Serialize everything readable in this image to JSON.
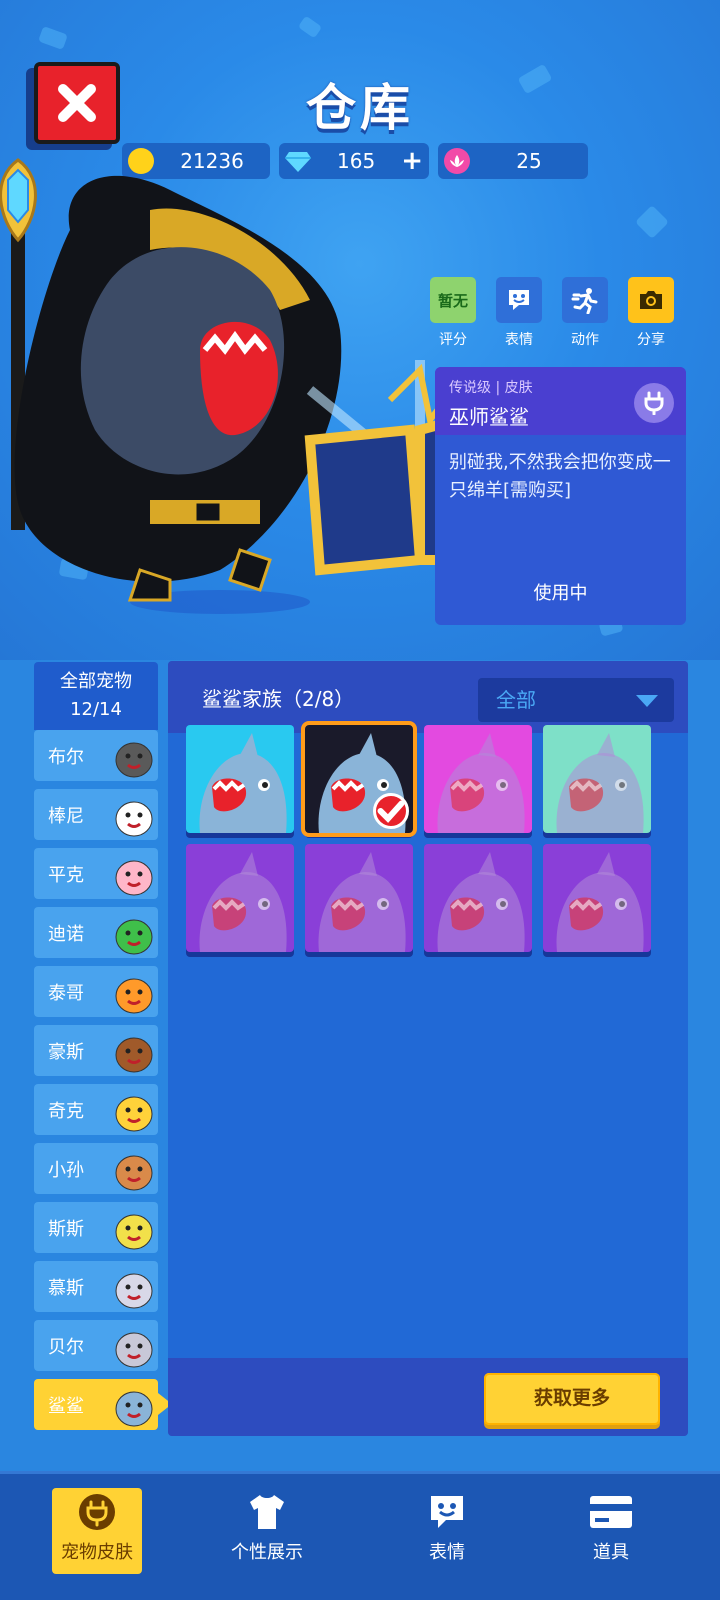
{
  "header": {
    "title": "仓库",
    "coins": "21236",
    "gems": "165",
    "gems_plus": "+",
    "lotus": "25"
  },
  "actions": [
    {
      "box_text": "暂无",
      "label": "评分",
      "icon": "rating-badge",
      "color": "#8ed36e"
    },
    {
      "box_text": "",
      "label": "表情",
      "icon": "emoji-icon",
      "color": "#2f6fd8"
    },
    {
      "box_text": "",
      "label": "动作",
      "icon": "running-icon",
      "color": "#2f6fd8"
    },
    {
      "box_text": "",
      "label": "分享",
      "icon": "camera-icon",
      "color": "#ffc21a"
    }
  ],
  "skin_info": {
    "rarity": "传说级",
    "type": "皮肤",
    "name": "巫师鲨鲨",
    "description": "别碰我,不然我会把你变成一只绵羊[需购买]",
    "status": "使用中"
  },
  "pets": {
    "all_label": "全部宠物",
    "all_count": "12/14",
    "items": [
      {
        "name": "布尔",
        "icon": "bull-icon",
        "color": "#5a5a5a"
      },
      {
        "name": "棒尼",
        "icon": "rabbit-icon",
        "color": "#ffffff"
      },
      {
        "name": "平克",
        "icon": "pig-icon",
        "color": "#ffb6c8"
      },
      {
        "name": "迪诺",
        "icon": "dino-icon",
        "color": "#3fbf4a"
      },
      {
        "name": "泰哥",
        "icon": "tiger-icon",
        "color": "#ff9a2a"
      },
      {
        "name": "豪斯",
        "icon": "horse-icon",
        "color": "#a05a2a"
      },
      {
        "name": "奇克",
        "icon": "chick-icon",
        "color": "#ffd23a"
      },
      {
        "name": "小孙",
        "icon": "monkey-icon",
        "color": "#d98a4a"
      },
      {
        "name": "斯斯",
        "icon": "snake-icon",
        "color": "#f2e04a"
      },
      {
        "name": "慕斯",
        "icon": "mouse-icon",
        "color": "#d8d8e8"
      },
      {
        "name": "贝尔",
        "icon": "seal-icon",
        "color": "#c8c8d8"
      },
      {
        "name": "鲨鲨",
        "icon": "shark-icon",
        "color": "#8ab4d8"
      }
    ],
    "active_index": 11
  },
  "skins_panel": {
    "family_label": "鲨鲨家族（2/8）",
    "filter_value": "全部",
    "get_more": "获取更多",
    "tiles": [
      {
        "name": "shark-default-skin",
        "bg": "#29c9f0",
        "owned": true,
        "selected": false
      },
      {
        "name": "shark-wizard-skin",
        "bg": "#1a1a2a",
        "owned": true,
        "selected": true
      },
      {
        "name": "shark-mushroom-skin",
        "bg": "#e34ae0",
        "owned": false,
        "selected": false
      },
      {
        "name": "shark-dino-skin",
        "bg": "#7ee0c8",
        "owned": false,
        "selected": false
      },
      {
        "name": "shark-sailor-skin",
        "bg": "#8a3fd8",
        "owned": false,
        "selected": false
      },
      {
        "name": "shark-pirate-skin",
        "bg": "#8a3fd8",
        "owned": false,
        "selected": false
      },
      {
        "name": "shark-pilot-skin",
        "bg": "#8a3fd8",
        "owned": false,
        "selected": false
      },
      {
        "name": "shark-astronaut-skin",
        "bg": "#8a3fd8",
        "owned": false,
        "selected": false
      }
    ]
  },
  "nav": [
    {
      "label": "宠物皮肤",
      "icon": "plug-icon",
      "active": true
    },
    {
      "label": "个性展示",
      "icon": "tshirt-icon",
      "active": false
    },
    {
      "label": "表情",
      "icon": "emoji-icon",
      "active": false
    },
    {
      "label": "道具",
      "icon": "card-icon",
      "active": false
    }
  ],
  "colors": {
    "background": "#2a86e0",
    "accent": "#ffd234",
    "close": "#e8222b"
  }
}
